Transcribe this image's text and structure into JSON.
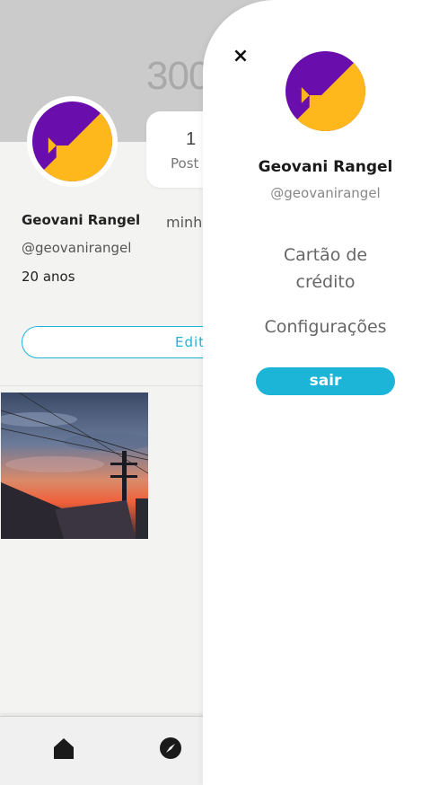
{
  "profile": {
    "cover_text": "300",
    "name": "Geovani Rangel",
    "username": "@geovanirangel",
    "age": "20 anos",
    "bio_partial": "minh",
    "stats": {
      "posts_count": "1",
      "posts_label": "Post"
    },
    "edit_label": "Edit"
  },
  "drawer": {
    "close_icon": "×",
    "name": "Geovani Rangel",
    "username": "@geovanirangel",
    "menu": {
      "card_line1": "Cartão de",
      "card_line2": "crédito",
      "settings": "Configurações"
    },
    "logout_label": "sair"
  },
  "nav": {
    "items": [
      {
        "icon": "home-icon"
      },
      {
        "icon": "compass-icon"
      }
    ]
  },
  "colors": {
    "accent": "#1cb5d8",
    "avatar_purple": "#6a0dad",
    "avatar_yellow": "#ffb81c"
  }
}
